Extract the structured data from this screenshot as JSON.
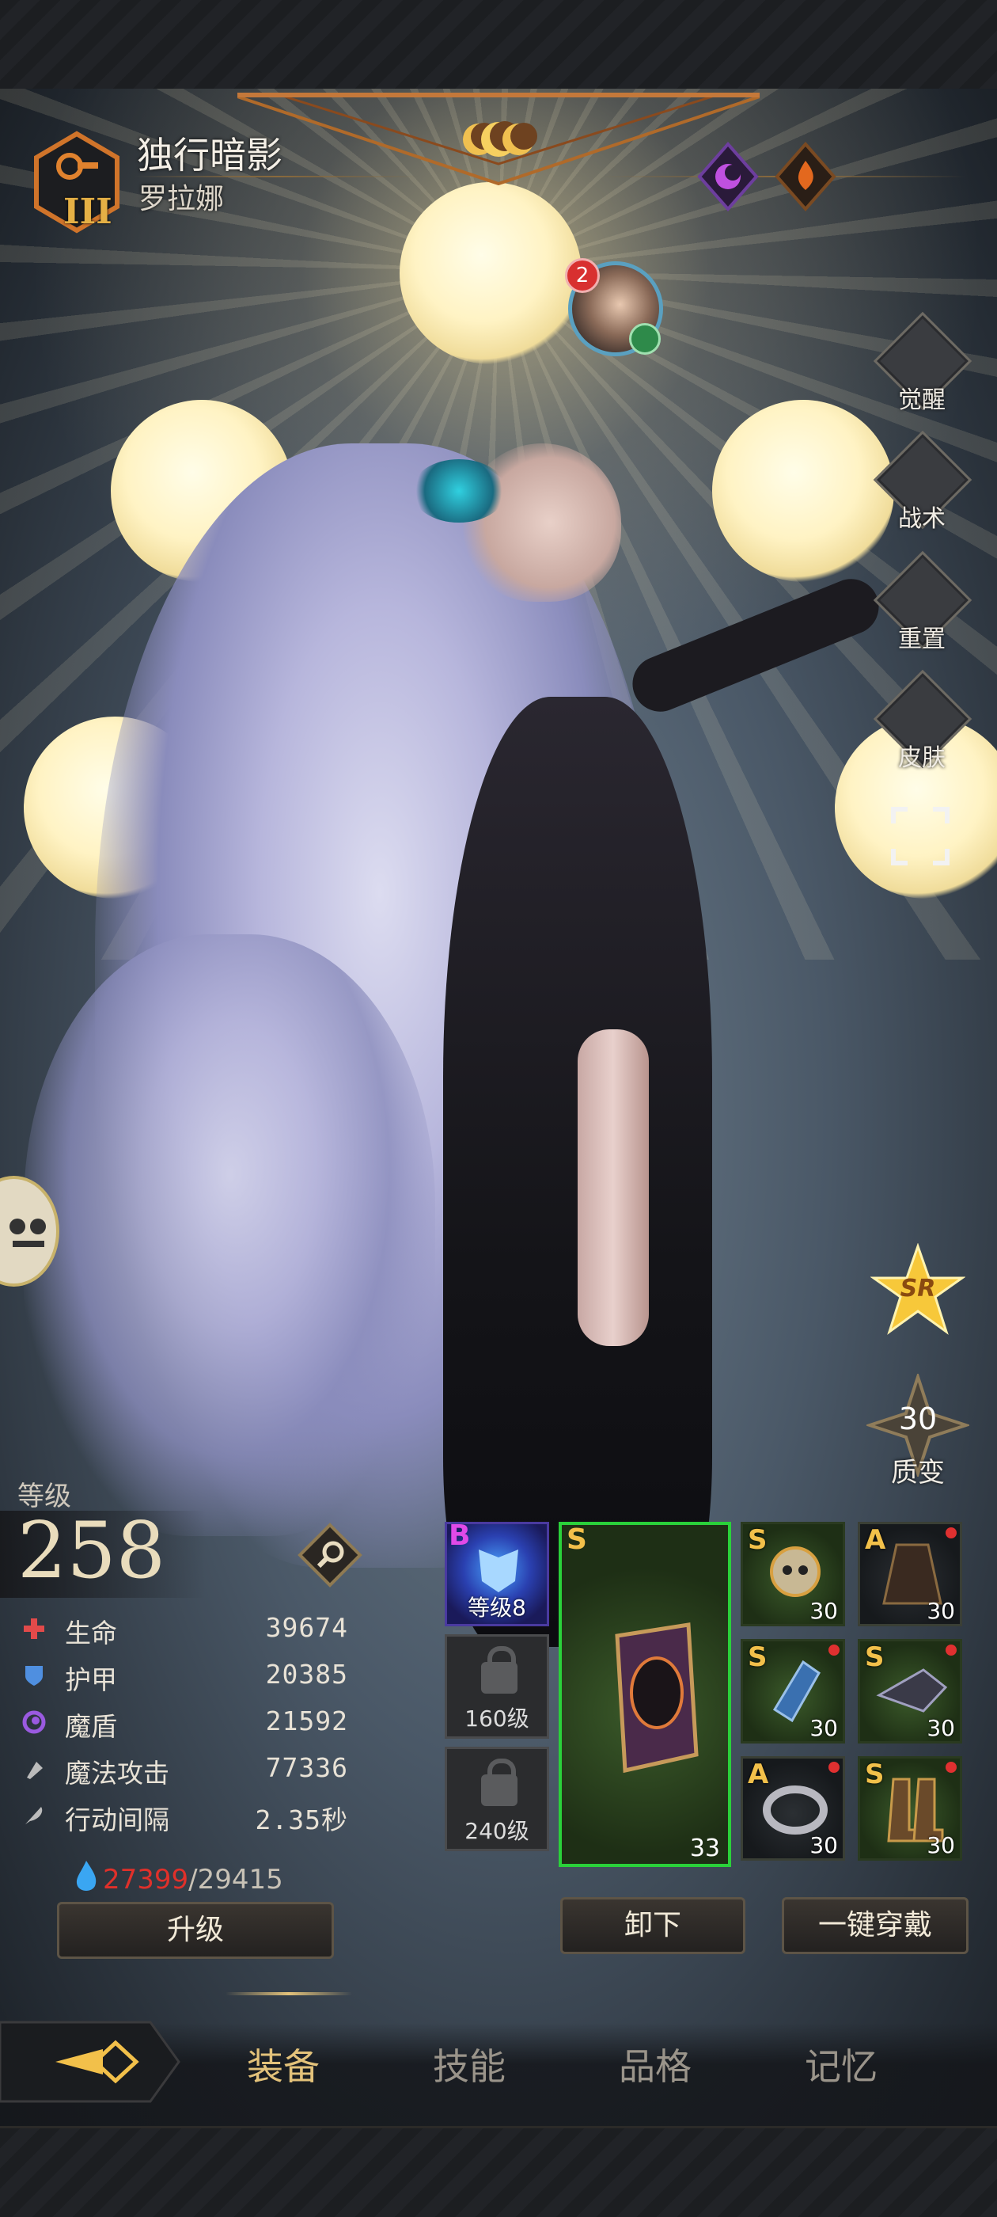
{
  "hero": {
    "title": "独行暗影",
    "name": "罗拉娜",
    "rank_numeral": "III"
  },
  "avatar": {
    "badge_count": "2"
  },
  "side_menu": [
    {
      "label": "觉醒",
      "icon": "sun-icon"
    },
    {
      "label": "战术",
      "icon": "banner-icon"
    },
    {
      "label": "重置",
      "icon": "helmet-icon"
    },
    {
      "label": "皮肤",
      "icon": "armor-icon"
    }
  ],
  "rarity_badge": "SR",
  "transmute": {
    "value": "30",
    "label": "质变"
  },
  "level": {
    "label": "等级",
    "value": "258"
  },
  "stats": [
    {
      "name": "生命",
      "value": "39674",
      "icon": "heart-cross-icon",
      "color": "#e24a4a"
    },
    {
      "name": "护甲",
      "value": "20385",
      "icon": "shield-icon",
      "color": "#4f8fe0"
    },
    {
      "name": "魔盾",
      "value": "21592",
      "icon": "swirl-icon",
      "color": "#9a5ae0"
    },
    {
      "name": "魔法攻击",
      "value": "77336",
      "icon": "magic-hand-icon",
      "color": "#bbbbbb"
    },
    {
      "name": "行动间隔",
      "value": "2.35秒",
      "icon": "feather-icon",
      "color": "#bbbbbb"
    }
  ],
  "exp": {
    "current": "27399",
    "max": "/29415"
  },
  "buttons": {
    "upgrade": "升级",
    "unequip": "卸下",
    "equip_all": "一键穿戴"
  },
  "equipment": {
    "artifact": {
      "rank": "B",
      "label": "等级8"
    },
    "locks": [
      "160级",
      "240级"
    ],
    "main": {
      "rank": "S",
      "level": "33"
    },
    "slots": [
      {
        "rank": "S",
        "level": "30",
        "item": "skull-mask-icon"
      },
      {
        "rank": "A",
        "level": "30",
        "item": "cloak-icon"
      },
      {
        "rank": "S",
        "level": "30",
        "item": "gauntlet-icon"
      },
      {
        "rank": "S",
        "level": "30",
        "item": "helmet-icon"
      },
      {
        "rank": "A",
        "level": "30",
        "item": "ring-icon"
      },
      {
        "rank": "S",
        "level": "30",
        "item": "boots-icon"
      }
    ]
  },
  "tabs": [
    {
      "label": "装备",
      "active": true
    },
    {
      "label": "技能",
      "active": false
    },
    {
      "label": "品格",
      "active": false
    },
    {
      "label": "记忆",
      "active": false
    }
  ],
  "colors": {
    "accent_gold": "#e3c27a",
    "exp_red": "#e0302a",
    "rank_gold": "#f2c04a"
  }
}
